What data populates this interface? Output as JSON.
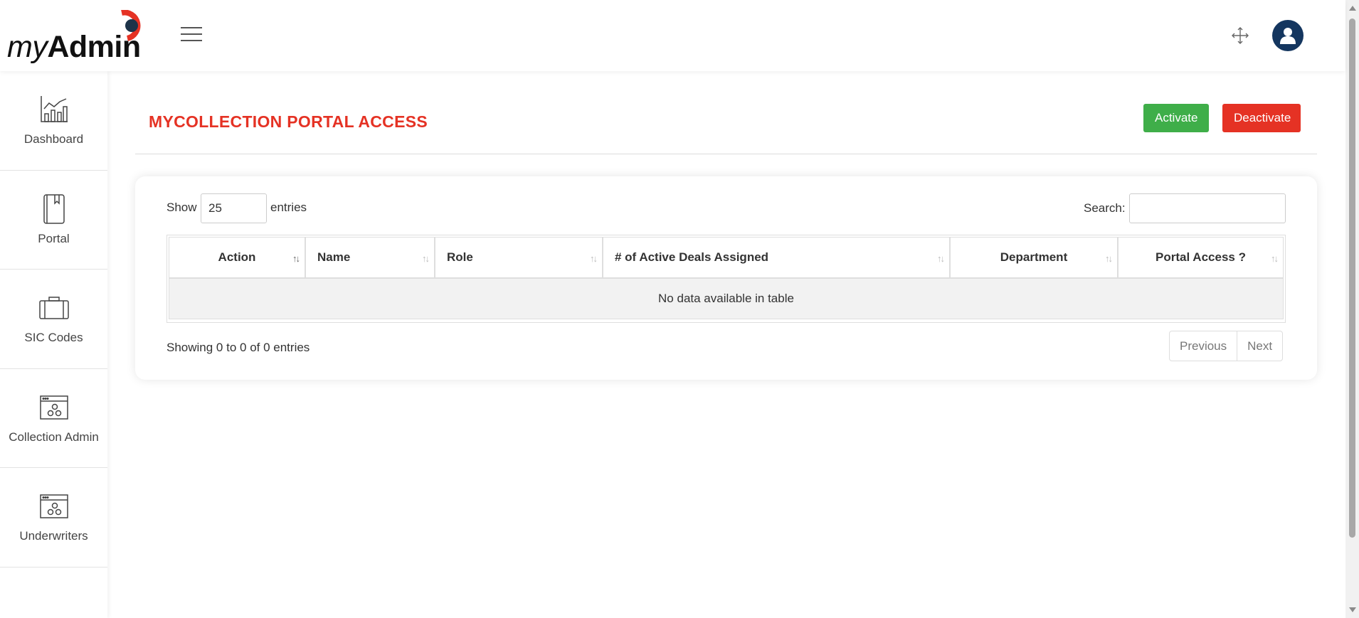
{
  "header": {
    "logo_text_my": "my",
    "logo_text_admin": "Admin",
    "menu_icon": "hamburger-icon",
    "fullscreen_icon": "expand-arrows-icon",
    "avatar_icon": "user-icon",
    "brand_color": "#e53224",
    "avatar_color": "#14365f"
  },
  "sidebar": {
    "items": [
      {
        "label": "Dashboard",
        "icon": "chart-icon"
      },
      {
        "label": "Portal",
        "icon": "book-icon"
      },
      {
        "label": "SIC Codes",
        "icon": "briefcase-icon"
      },
      {
        "label": "Collection Admin",
        "icon": "settings-window-icon"
      },
      {
        "label": "Underwriters",
        "icon": "settings-window-icon"
      }
    ]
  },
  "page": {
    "title": "MYCOLLECTION PORTAL ACCESS",
    "activate_label": "Activate",
    "deactivate_label": "Deactivate",
    "activate_color": "#3fae49",
    "deactivate_color": "#e53224"
  },
  "table_controls": {
    "show_label": "Show",
    "page_length": "25",
    "entries_label": "entries",
    "search_label": "Search:",
    "search_value": ""
  },
  "table": {
    "columns": [
      "Action",
      "Name",
      "Role",
      "# of Active Deals Assigned",
      "Department",
      "Portal Access ?"
    ],
    "empty_message": "No data available in table"
  },
  "footer": {
    "info": "Showing 0 to 0 of 0 entries",
    "previous_label": "Previous",
    "next_label": "Next"
  }
}
